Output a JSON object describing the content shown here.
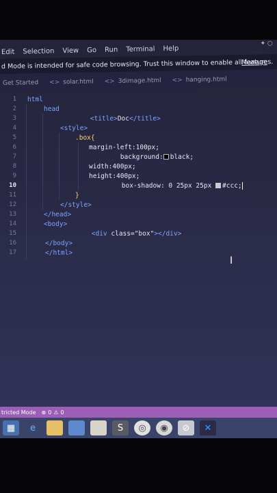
{
  "menu": [
    "Edit",
    "Selection",
    "View",
    "Go",
    "Run",
    "Terminal",
    "Help"
  ],
  "banner": {
    "text": "d Mode is intended for safe code browsing. Trust this window to enable all features.",
    "link": "Manage"
  },
  "tabs": [
    {
      "label": "Get Started",
      "icon": ""
    },
    {
      "label": "solar.html",
      "icon": "<>"
    },
    {
      "label": "3dimage.html",
      "icon": "<>"
    },
    {
      "label": "hanging.html",
      "icon": "<>"
    }
  ],
  "code_lines": [
    {
      "n": "1",
      "text": "html"
    },
    {
      "n": "2",
      "text": "head"
    },
    {
      "n": "3",
      "title_open": "<title>",
      "title_text": "Doc",
      "title_close": "</title>"
    },
    {
      "n": "4",
      "text": "<style>"
    },
    {
      "n": "5",
      "text": ".box{"
    },
    {
      "n": "6",
      "text": "margin-left:100px;"
    },
    {
      "n": "7",
      "prop": "background:",
      "value": "black;"
    },
    {
      "n": "8",
      "text": "width:400px;"
    },
    {
      "n": "9",
      "text": "height:400px;"
    },
    {
      "n": "10",
      "prop": "box-shadow: 0 25px 25px ",
      "value": "#ccc;"
    },
    {
      "n": "11",
      "text": "}"
    },
    {
      "n": "12",
      "text": "</style>"
    },
    {
      "n": "13",
      "text": "</head>"
    },
    {
      "n": "14",
      "text": "<body>"
    },
    {
      "n": "15",
      "div_open": "<div ",
      "attr": "class=\"box\"",
      "div_close": "></div>"
    },
    {
      "n": "16",
      "text": "</body>"
    },
    {
      "n": "17",
      "text": "</html>"
    }
  ],
  "status": {
    "mode": "tricted Mode",
    "errors": "0",
    "warnings": "0"
  },
  "colors": {
    "status_bar": "#9b5fb8",
    "tag": "#7aa6ff",
    "selector": "#ffd479"
  },
  "taskbar_icons": [
    "start-icon",
    "ie-icon",
    "folder-icon",
    "store-icon",
    "file-icon",
    "sublime-icon",
    "chrome-icon",
    "browser-icon",
    "app-icon",
    "vscode-icon"
  ]
}
